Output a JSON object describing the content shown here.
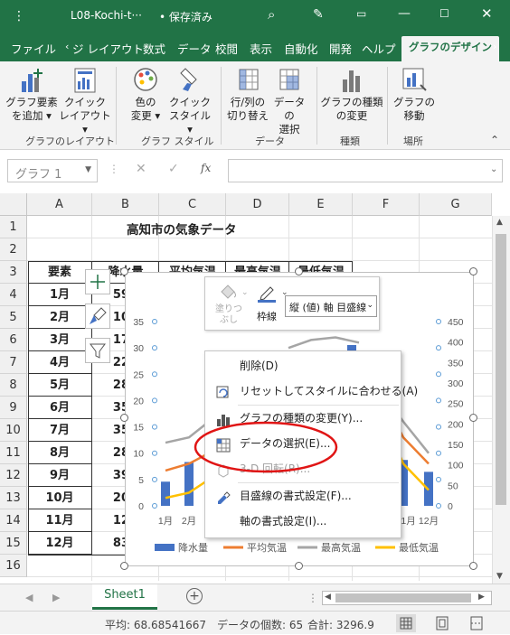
{
  "titlebar": {
    "filename": "L08-Kochi-t···",
    "save_state": "• 保存済み"
  },
  "tabs": [
    "ファイル",
    "ジ レイアウト",
    "数式",
    "データ",
    "校閲",
    "表示",
    "自動化",
    "開発",
    "ヘルプ",
    "グラフのデザイン"
  ],
  "ribbon": {
    "buttons": [
      {
        "label1": "グラフ要素",
        "label2": "を追加 ▾"
      },
      {
        "label1": "クイック",
        "label2": "レイアウト ▾"
      },
      {
        "label1": "色の",
        "label2": "変更 ▾"
      },
      {
        "label1": "クイック",
        "label2": "スタイル ▾"
      },
      {
        "label1": "行/列の",
        "label2": "切り替え"
      },
      {
        "label1": "データの",
        "label2": "選択"
      },
      {
        "label1": "グラフの種類",
        "label2": "の変更"
      },
      {
        "label1": "グラフの",
        "label2": "移動"
      }
    ],
    "groups": [
      "グラフのレイアウト",
      "グラフ スタイル",
      "データ",
      "種類",
      "場所"
    ]
  },
  "formula_bar": {
    "name_box": "グラフ 1",
    "fx": "fx"
  },
  "columns": [
    "A",
    "B",
    "C",
    "D",
    "E",
    "F",
    "G"
  ],
  "rows": [
    "1",
    "2",
    "3",
    "4",
    "5",
    "6",
    "7",
    "8",
    "9",
    "10",
    "11",
    "12",
    "13",
    "14",
    "15",
    "16"
  ],
  "sheet": {
    "title": "高知市の気象データ",
    "headers": [
      "要素",
      "降水量",
      "平均気温",
      "最高気温",
      "最低気温"
    ],
    "months": [
      "1月",
      "2月",
      "3月",
      "4月",
      "5月",
      "6月",
      "7月",
      "8月",
      "9月",
      "10月",
      "11月",
      "12月"
    ],
    "precip_visible": [
      "59",
      "10",
      "17",
      "22",
      "28",
      "35",
      "35",
      "28",
      "39",
      "20",
      "12",
      "83"
    ]
  },
  "chart_data": {
    "type": "bar",
    "left_axis_ticks": [
      "35",
      "30",
      "25",
      "20",
      "15",
      "10",
      "5",
      "0"
    ],
    "right_axis_ticks": [
      "450",
      "400",
      "350",
      "300",
      "250",
      "200",
      "150",
      "100",
      "50",
      "0"
    ],
    "x_labels_visible": [
      "1月",
      "2月",
      "11月",
      "12月"
    ],
    "legend": [
      "降水量",
      "平均気温",
      "最高気温",
      "最低気温"
    ],
    "colors": {
      "precip": "#4472c4",
      "avg": "#ed7d31",
      "max": "#a5a5a5",
      "min": "#ffc000"
    }
  },
  "mini_toolbar": {
    "fill": "塗りつ\nぶし",
    "outline": "枠線",
    "target": "縦 (値) 軸 目盛線"
  },
  "context_menu": [
    "削除(D)",
    "リセットしてスタイルに合わせる(A)",
    "グラフの種類の変更(Y)...",
    "データの選択(E)...",
    "3-D 回転(R)...",
    "目盛線の書式設定(F)...",
    "軸の書式設定(I)..."
  ],
  "sheet_tab": "Sheet1",
  "status": {
    "avg": "平均: 68.68541667",
    "count": "データの個数: 65",
    "sum": "合計: 3296.9"
  }
}
